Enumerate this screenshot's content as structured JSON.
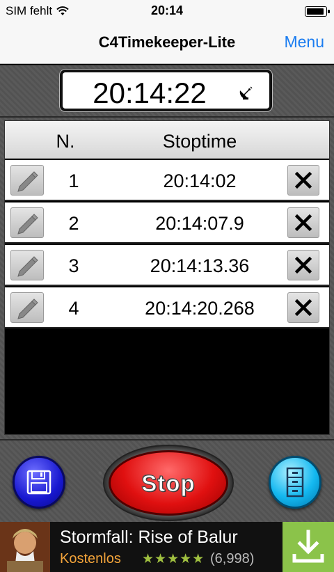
{
  "status_bar": {
    "carrier": "SIM fehlt",
    "time": "20:14"
  },
  "nav": {
    "title": "C4Timekeeper-Lite",
    "menu_label": "Menu"
  },
  "clock": {
    "time": "20:14:22"
  },
  "table": {
    "header_n": "N.",
    "header_stoptime": "Stoptime",
    "rows": [
      {
        "n": "1",
        "time": "20:14:02"
      },
      {
        "n": "2",
        "time": "20:14:07.9"
      },
      {
        "n": "3",
        "time": "20:14:13.36"
      },
      {
        "n": "4",
        "time": "20:14:20.268"
      }
    ]
  },
  "controls": {
    "stop_label": "Stop"
  },
  "ad": {
    "title": "Stormfall: Rise of Balur",
    "price": "Kostenlos",
    "stars": "★★★★★",
    "star_rating": 4.5,
    "rating_count": "(6,998)"
  },
  "colors": {
    "accent": "#1a7cf0",
    "stop": "#e01010",
    "save": "#1818d0",
    "archive": "#14b8f0",
    "ad_download": "#8bc34a"
  }
}
